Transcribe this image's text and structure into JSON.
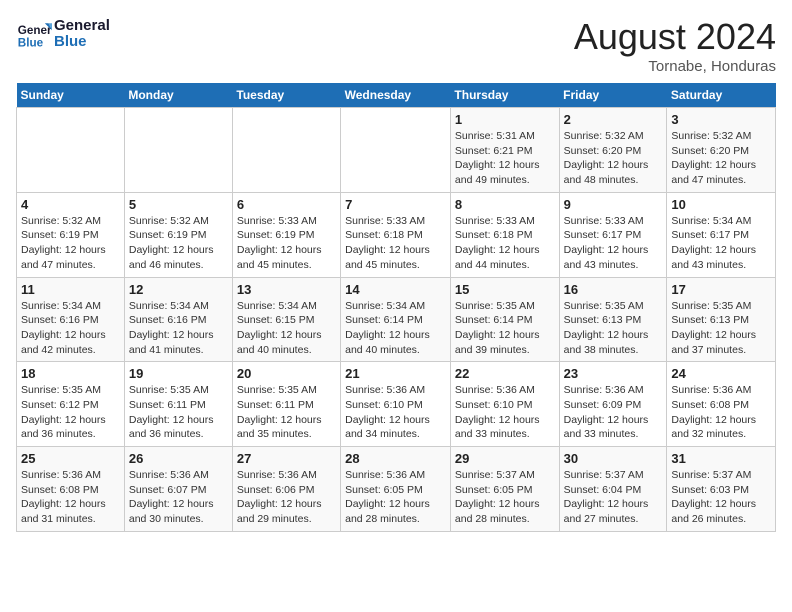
{
  "header": {
    "logo_line1": "General",
    "logo_line2": "Blue",
    "month_title": "August 2024",
    "subtitle": "Tornabe, Honduras"
  },
  "days_of_week": [
    "Sunday",
    "Monday",
    "Tuesday",
    "Wednesday",
    "Thursday",
    "Friday",
    "Saturday"
  ],
  "weeks": [
    [
      {
        "day": "",
        "info": ""
      },
      {
        "day": "",
        "info": ""
      },
      {
        "day": "",
        "info": ""
      },
      {
        "day": "",
        "info": ""
      },
      {
        "day": "1",
        "info": "Sunrise: 5:31 AM\nSunset: 6:21 PM\nDaylight: 12 hours\nand 49 minutes."
      },
      {
        "day": "2",
        "info": "Sunrise: 5:32 AM\nSunset: 6:20 PM\nDaylight: 12 hours\nand 48 minutes."
      },
      {
        "day": "3",
        "info": "Sunrise: 5:32 AM\nSunset: 6:20 PM\nDaylight: 12 hours\nand 47 minutes."
      }
    ],
    [
      {
        "day": "4",
        "info": "Sunrise: 5:32 AM\nSunset: 6:19 PM\nDaylight: 12 hours\nand 47 minutes."
      },
      {
        "day": "5",
        "info": "Sunrise: 5:32 AM\nSunset: 6:19 PM\nDaylight: 12 hours\nand 46 minutes."
      },
      {
        "day": "6",
        "info": "Sunrise: 5:33 AM\nSunset: 6:19 PM\nDaylight: 12 hours\nand 45 minutes."
      },
      {
        "day": "7",
        "info": "Sunrise: 5:33 AM\nSunset: 6:18 PM\nDaylight: 12 hours\nand 45 minutes."
      },
      {
        "day": "8",
        "info": "Sunrise: 5:33 AM\nSunset: 6:18 PM\nDaylight: 12 hours\nand 44 minutes."
      },
      {
        "day": "9",
        "info": "Sunrise: 5:33 AM\nSunset: 6:17 PM\nDaylight: 12 hours\nand 43 minutes."
      },
      {
        "day": "10",
        "info": "Sunrise: 5:34 AM\nSunset: 6:17 PM\nDaylight: 12 hours\nand 43 minutes."
      }
    ],
    [
      {
        "day": "11",
        "info": "Sunrise: 5:34 AM\nSunset: 6:16 PM\nDaylight: 12 hours\nand 42 minutes."
      },
      {
        "day": "12",
        "info": "Sunrise: 5:34 AM\nSunset: 6:16 PM\nDaylight: 12 hours\nand 41 minutes."
      },
      {
        "day": "13",
        "info": "Sunrise: 5:34 AM\nSunset: 6:15 PM\nDaylight: 12 hours\nand 40 minutes."
      },
      {
        "day": "14",
        "info": "Sunrise: 5:34 AM\nSunset: 6:14 PM\nDaylight: 12 hours\nand 40 minutes."
      },
      {
        "day": "15",
        "info": "Sunrise: 5:35 AM\nSunset: 6:14 PM\nDaylight: 12 hours\nand 39 minutes."
      },
      {
        "day": "16",
        "info": "Sunrise: 5:35 AM\nSunset: 6:13 PM\nDaylight: 12 hours\nand 38 minutes."
      },
      {
        "day": "17",
        "info": "Sunrise: 5:35 AM\nSunset: 6:13 PM\nDaylight: 12 hours\nand 37 minutes."
      }
    ],
    [
      {
        "day": "18",
        "info": "Sunrise: 5:35 AM\nSunset: 6:12 PM\nDaylight: 12 hours\nand 36 minutes."
      },
      {
        "day": "19",
        "info": "Sunrise: 5:35 AM\nSunset: 6:11 PM\nDaylight: 12 hours\nand 36 minutes."
      },
      {
        "day": "20",
        "info": "Sunrise: 5:35 AM\nSunset: 6:11 PM\nDaylight: 12 hours\nand 35 minutes."
      },
      {
        "day": "21",
        "info": "Sunrise: 5:36 AM\nSunset: 6:10 PM\nDaylight: 12 hours\nand 34 minutes."
      },
      {
        "day": "22",
        "info": "Sunrise: 5:36 AM\nSunset: 6:10 PM\nDaylight: 12 hours\nand 33 minutes."
      },
      {
        "day": "23",
        "info": "Sunrise: 5:36 AM\nSunset: 6:09 PM\nDaylight: 12 hours\nand 33 minutes."
      },
      {
        "day": "24",
        "info": "Sunrise: 5:36 AM\nSunset: 6:08 PM\nDaylight: 12 hours\nand 32 minutes."
      }
    ],
    [
      {
        "day": "25",
        "info": "Sunrise: 5:36 AM\nSunset: 6:08 PM\nDaylight: 12 hours\nand 31 minutes."
      },
      {
        "day": "26",
        "info": "Sunrise: 5:36 AM\nSunset: 6:07 PM\nDaylight: 12 hours\nand 30 minutes."
      },
      {
        "day": "27",
        "info": "Sunrise: 5:36 AM\nSunset: 6:06 PM\nDaylight: 12 hours\nand 29 minutes."
      },
      {
        "day": "28",
        "info": "Sunrise: 5:36 AM\nSunset: 6:05 PM\nDaylight: 12 hours\nand 28 minutes."
      },
      {
        "day": "29",
        "info": "Sunrise: 5:37 AM\nSunset: 6:05 PM\nDaylight: 12 hours\nand 28 minutes."
      },
      {
        "day": "30",
        "info": "Sunrise: 5:37 AM\nSunset: 6:04 PM\nDaylight: 12 hours\nand 27 minutes."
      },
      {
        "day": "31",
        "info": "Sunrise: 5:37 AM\nSunset: 6:03 PM\nDaylight: 12 hours\nand 26 minutes."
      }
    ]
  ]
}
